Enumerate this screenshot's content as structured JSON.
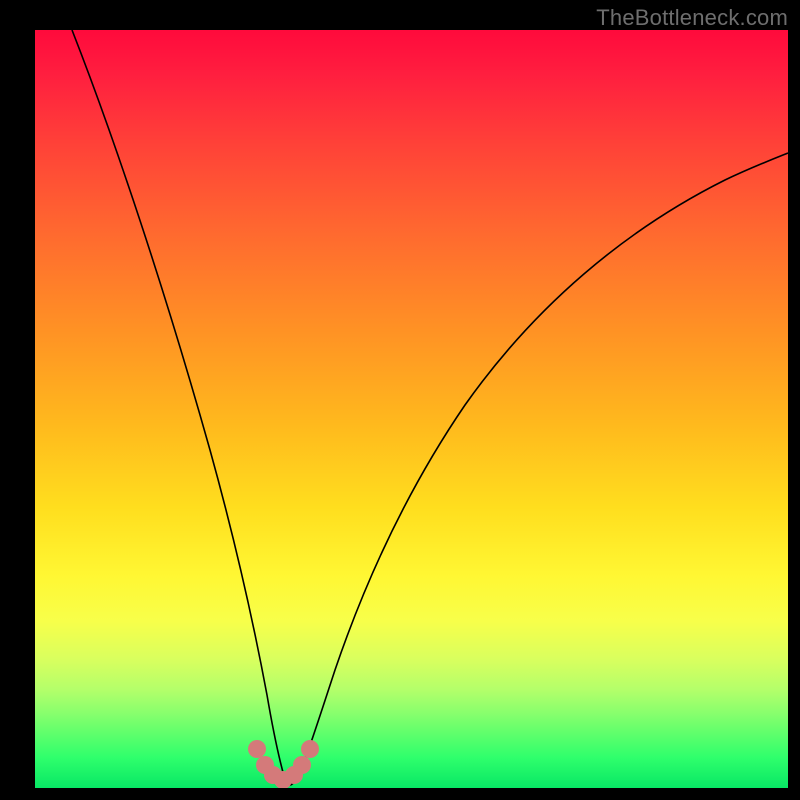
{
  "watermark": "TheBottleneck.com",
  "chart_data": {
    "type": "line",
    "title": "",
    "xlabel": "",
    "ylabel": "",
    "xlim": [
      0,
      100
    ],
    "ylim": [
      0,
      100
    ],
    "grid": false,
    "legend": false,
    "background_gradient": {
      "direction": "vertical",
      "stops": [
        {
          "pos": 0,
          "color": "#ff0a3c"
        },
        {
          "pos": 50,
          "color": "#ffbf1f"
        },
        {
          "pos": 78,
          "color": "#f7ff4a"
        },
        {
          "pos": 100,
          "color": "#08e765"
        }
      ]
    },
    "series": [
      {
        "name": "curve-black",
        "color": "#000000",
        "width": 1.4,
        "x": [
          5,
          8,
          11,
          14,
          17,
          20,
          22,
          24,
          26,
          27.5,
          29,
          30,
          31,
          32,
          33,
          34,
          35,
          36.5,
          38,
          40,
          42,
          44,
          47,
          50,
          54,
          58,
          63,
          68,
          74,
          80,
          87,
          94,
          100
        ],
        "y": [
          100,
          91,
          82,
          73,
          64,
          55,
          47,
          39,
          31,
          24,
          17,
          11,
          6,
          2.5,
          0.8,
          0.8,
          2.5,
          6,
          11,
          17,
          23,
          29,
          36,
          42,
          49,
          55,
          61,
          66,
          71,
          75,
          79,
          82,
          85
        ]
      },
      {
        "name": "dots-pink",
        "type": "scatter",
        "color": "#d47a7a",
        "radius": 12,
        "x": [
          29.5,
          30.5,
          31.5,
          33,
          34.5,
          35.5,
          36.5
        ],
        "y": [
          5.2,
          3.0,
          1.6,
          1.0,
          1.6,
          3.0,
          5.2
        ]
      }
    ]
  }
}
